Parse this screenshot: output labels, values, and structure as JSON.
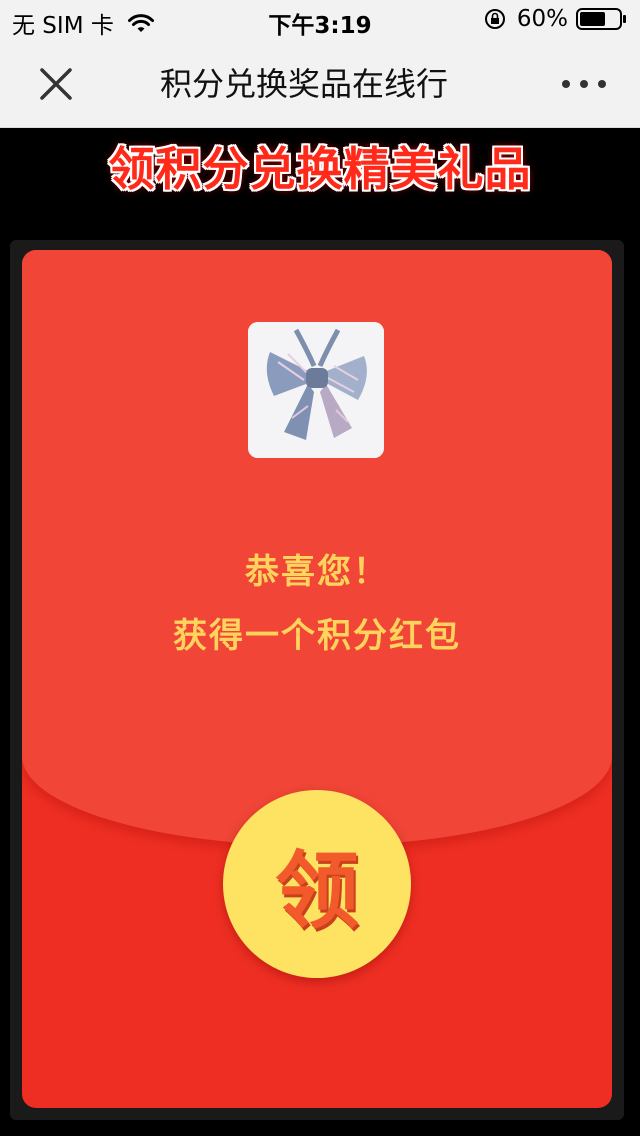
{
  "status_bar": {
    "carrier": "无 SIM 卡",
    "time": "下午3:19",
    "battery": "60%",
    "battery_level": 0.6,
    "icons": [
      "wifi-icon",
      "orientation-lock-icon",
      "battery-icon"
    ]
  },
  "nav": {
    "title": "积分兑换奖品在线行",
    "close_icon": "close-icon",
    "more_icon": "more-icon"
  },
  "banner": {
    "text": "领积分兑换精美礼品"
  },
  "envelope": {
    "congrats_line1": "恭喜您！",
    "congrats_line2": "获得一个积分红包",
    "claim_label": "领",
    "product_icon": "bow-tie-image"
  },
  "colors": {
    "envelope_red": "#ee2e22",
    "envelope_top": "#f04537",
    "gold_text": "#ffd35c",
    "button_yellow": "#fde361",
    "banner_red": "#ff2a1a"
  }
}
